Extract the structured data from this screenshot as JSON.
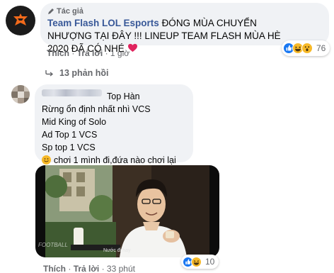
{
  "comment1": {
    "author_tag": "Tác giả",
    "author_name": "Team Flash LOL Esports",
    "text": "ĐÓNG MÙA CHUYỂN NHƯỢNG TẠI ĐÂY !!! LINEUP TEAM FLASH MÙA HÈ 2020 ĐÃ CÓ NHÉ",
    "emoji": "red-heart",
    "reaction_count": "76",
    "reactions": [
      "like",
      "haha",
      "wow"
    ],
    "actions": {
      "like": "Thích",
      "reply": "Trả lời",
      "time": "1 giờ"
    }
  },
  "replies": {
    "label": "13 phản hồi"
  },
  "comment2": {
    "author_name_suffix": "Top Hàn",
    "lines": [
      "Rừng ổn định nhất nhì VCS",
      "Mid King of Solo",
      "Ad Top 1 VCS",
      "Sp top 1 VCS"
    ],
    "last_line": "chơi 1 mình đi,đứa nào chơi lại",
    "video_caption": "Nước đi hay",
    "video_watermark": "FOOTBALL",
    "reaction_count": "10",
    "reactions": [
      "like",
      "haha"
    ],
    "actions": {
      "like": "Thích",
      "reply": "Trả lời",
      "time": "33 phút"
    }
  },
  "colors": {
    "author_link": "#385898",
    "bubble_bg": "#f0f2f5",
    "meta_text": "#65676b",
    "like_blue": "#1877f2",
    "emoji_yellow": "#f7b928",
    "heart_red": "#e0245e"
  }
}
